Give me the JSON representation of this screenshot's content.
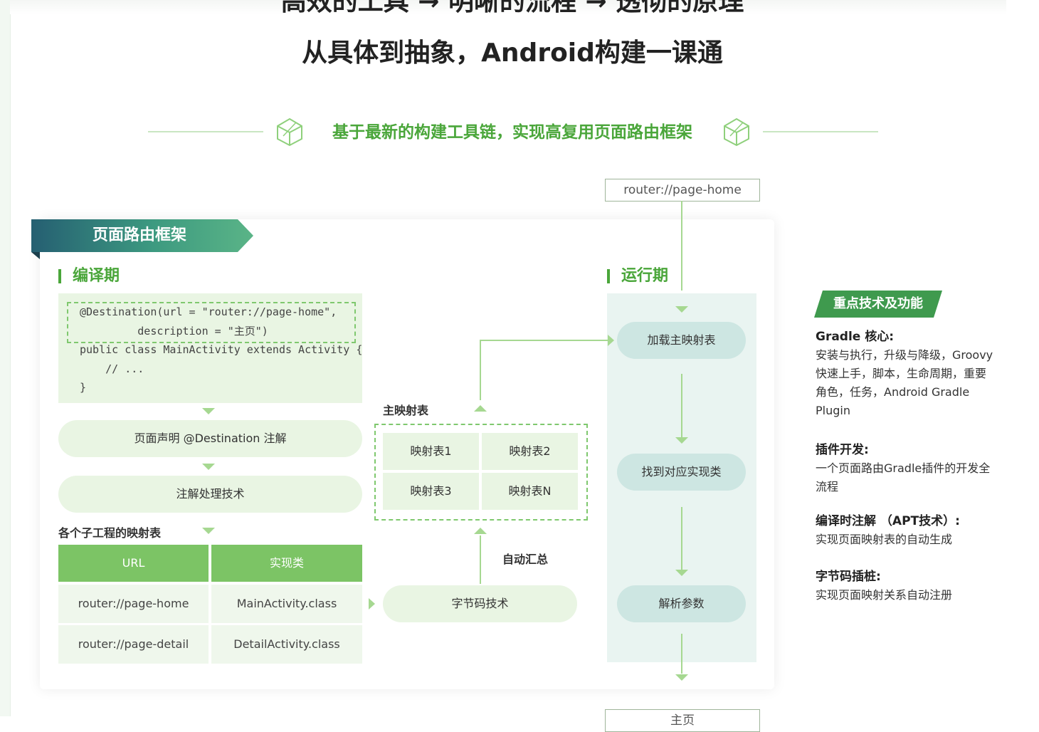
{
  "headline": {
    "line1": "高效的工具 → 明晰的流程 → 透彻的原理",
    "line2": "从具体到抽象，Android构建一课通"
  },
  "banner": {
    "text": "基于最新的构建工具链，实现高复用页面路由框架"
  },
  "url_top": "router://page-home",
  "url_bottom": "主页",
  "diagram": {
    "ribbon_title": "页面路由框架",
    "compile_title": "编译期",
    "runtime_title": "运行期",
    "code": {
      "line1": "@Destination(url = \"router://page-home\",",
      "line2": "         description = \"主页\")",
      "line3": "public class MainActivity extends Activity {",
      "line4": "    // ...",
      "line5": "}"
    },
    "step_annotation": "页面声明 @Destination 注解",
    "step_processing": "注解处理技术",
    "sub_table_label": "各个子工程的映射表",
    "table": {
      "headers": [
        "URL",
        "实现类"
      ],
      "rows": [
        [
          "router://page-home",
          "MainActivity.class"
        ],
        [
          "router://page-detail",
          "DetailActivity.class"
        ]
      ]
    },
    "main_map_label": "主映射表",
    "maps": [
      "映射表1",
      "映射表2",
      "映射表3",
      "映射表N"
    ],
    "auto_summary": "自动汇总",
    "bytecode": "字节码技术",
    "runtime_steps": [
      "加载主映射表",
      "找到对应实现类",
      "解析参数"
    ]
  },
  "features": {
    "tag": "重点技术及功能",
    "items": [
      {
        "title": "Gradle 核心:",
        "body": "安装与执行，升级与降级，Groovy快速上手，脚本，生命周期，重要角色，任务，Android Gradle Plugin"
      },
      {
        "title": "插件开发:",
        "body": "一个页面路由Gradle插件的开发全流程"
      },
      {
        "title": "编译时注解 （APT技术）:",
        "body": "实现页面映射表的自动生成"
      },
      {
        "title": "字节码插桩:",
        "body": "实现页面映射关系自动注册"
      }
    ]
  },
  "colors": {
    "accent_green": "#4aa63a",
    "light_green": "#e9f5e3",
    "header_green": "#7cc465",
    "runtime_teal": "#cde6e2",
    "ribbon_dark": "#255f72"
  }
}
